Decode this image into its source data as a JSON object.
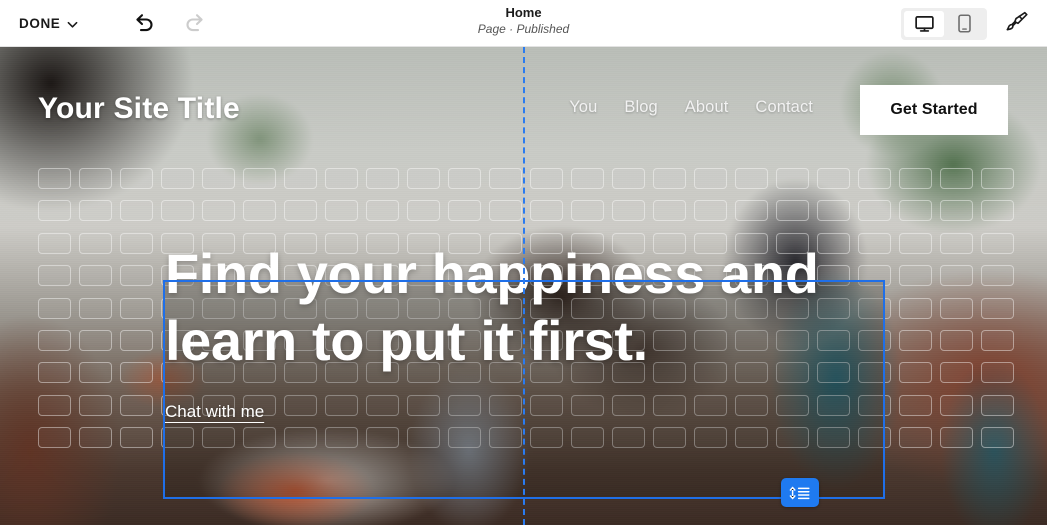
{
  "editor_bar": {
    "done_label": "DONE",
    "chevron_icon": "chevron-down-icon",
    "undo_icon": "undo-arrow-icon",
    "redo_icon": "redo-arrow-icon",
    "undo_enabled": true,
    "redo_enabled": false,
    "page_title": "Home",
    "page_status": "Page · Published",
    "devices": [
      {
        "name": "desktop",
        "icon": "desktop-monitor-icon",
        "active": true
      },
      {
        "name": "mobile",
        "icon": "mobile-phone-icon",
        "active": false
      }
    ],
    "theme_icon": "paintbrush-icon"
  },
  "site": {
    "title": "Your Site Title",
    "nav": [
      {
        "label": "You"
      },
      {
        "label": "Blog"
      },
      {
        "label": "About"
      },
      {
        "label": "Contact"
      }
    ],
    "cta_label": "Get Started",
    "hero": {
      "headline": "Find your happiness and learn to put it first.",
      "link_label": "Chat with me"
    }
  },
  "selection": {
    "accent_color": "#1f6fe8",
    "guide_color": "#2a7bf0",
    "handle_icon": "vertical-spacing-icon"
  },
  "grid": {
    "columns": 24,
    "rows": 9,
    "cell_border_color": "rgba(255,255,255,0.42)"
  }
}
